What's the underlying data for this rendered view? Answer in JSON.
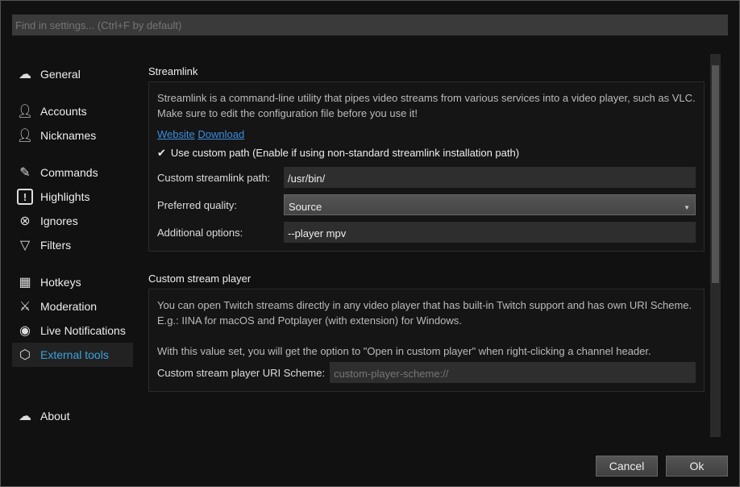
{
  "search": {
    "placeholder": "Find in settings... (Ctrl+F by default)"
  },
  "sidebar": {
    "items": [
      {
        "label": "General",
        "icon": "chatterino-logo-icon"
      },
      {
        "label": "Accounts",
        "icon": "user-icon"
      },
      {
        "label": "Nicknames",
        "icon": "user-icon"
      },
      {
        "label": "Commands",
        "icon": "commands-icon"
      },
      {
        "label": "Highlights",
        "icon": "exclamation-icon"
      },
      {
        "label": "Ignores",
        "icon": "x-circle-icon"
      },
      {
        "label": "Filters",
        "icon": "filter-icon"
      },
      {
        "label": "Hotkeys",
        "icon": "grid-icon"
      },
      {
        "label": "Moderation",
        "icon": "sword-icon"
      },
      {
        "label": "Live Notifications",
        "icon": "broadcast-icon"
      },
      {
        "label": "External tools",
        "icon": "gear-icon",
        "active": true
      },
      {
        "label": "About",
        "icon": "chatterino-logo-icon"
      }
    ]
  },
  "streamlink": {
    "title": "Streamlink",
    "description": "Streamlink is a command-line utility that pipes video streams from various services into a video player, such as VLC. Make sure to edit the configuration file before you use it!",
    "website": "Website",
    "download": "Download",
    "use_custom_path": "Use custom path",
    "use_custom_path_hint": "(Enable if using non-standard streamlink installation path)",
    "use_custom_path_checked": true,
    "path_label": "Custom streamlink path:",
    "path_value": "/usr/bin/",
    "quality_label": "Preferred quality:",
    "quality_value": "Source",
    "options_label": "Additional options:",
    "options_value": "--player mpv"
  },
  "custom_player": {
    "title": "Custom stream player",
    "line1": "You can open Twitch streams directly in any video player that has built-in Twitch support and has own URI Scheme.",
    "line2": "E.g.: IINA for macOS and Potplayer (with extension) for Windows.",
    "line3": "With this value set, you will get the option to \"Open in custom player\" when right-clicking a channel header.",
    "uri_label": "Custom stream player URI Scheme:",
    "uri_placeholder": "custom-player-scheme://"
  },
  "buttons": {
    "cancel": "Cancel",
    "ok": "Ok"
  },
  "colors": {
    "accent": "#3aa3e0",
    "link": "#3a8fe0"
  }
}
